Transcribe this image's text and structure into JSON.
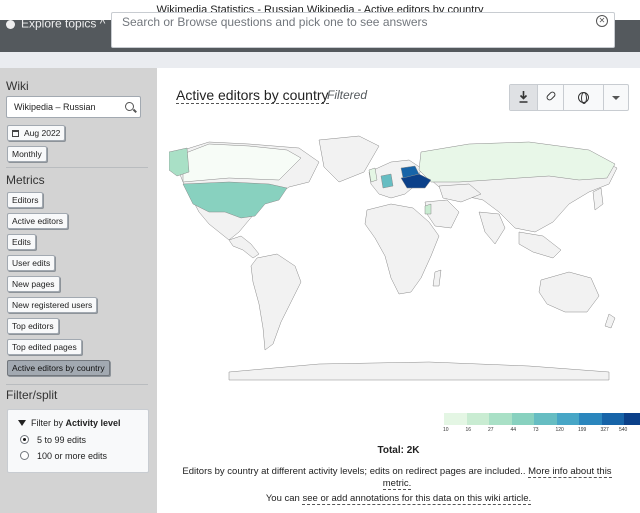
{
  "window": {
    "title": "Wikimedia Statistics - Russian Wikipedia - Active editors by country"
  },
  "topbar": {
    "explore_label": "Explore topics",
    "search_placeholder": "Search or Browse questions and pick one to see answers"
  },
  "sidebar": {
    "wiki_heading": "Wiki",
    "wiki_value": "Wikipedia – Russian",
    "date_label": "Aug 2022",
    "granularity_label": "Monthly",
    "metrics_heading": "Metrics",
    "metrics": [
      "Editors",
      "Active editors",
      "Edits",
      "User edits",
      "New pages",
      "New registered users",
      "Top editors",
      "Top edited pages",
      "Active editors by country"
    ],
    "active_metric": "Active editors by country",
    "filter_heading": "Filter/split",
    "filter_title_prefix": "Filter by",
    "filter_title_bold": "Activity level",
    "filter_options": [
      "5 to 99 edits",
      "100 or more edits"
    ],
    "filter_selected": "5 to 99 edits"
  },
  "main": {
    "title": "Active editors by country",
    "subtitle": "Filtered",
    "toolbar": {
      "download": "download-icon",
      "link": "link-icon",
      "language": "globe-icon",
      "more": "chevron-down-icon"
    },
    "legend": {
      "ticks": [
        "10",
        "16",
        "27",
        "44",
        "73",
        "120",
        "199",
        "327",
        "540"
      ],
      "colors": [
        "#e4f6e4",
        "#c9ecd2",
        "#a9e0c6",
        "#88d1bf",
        "#66bdc2",
        "#47a6c6",
        "#2b86bd",
        "#1764a8",
        "#0b4089"
      ]
    },
    "total": "Total: 2K",
    "description": "Editors by country at different activity levels; edits on redirect pages are included..",
    "more_info_link": "More info about this metric.",
    "annotation_prefix": "You can",
    "annotation_link": "see or add annotations for this data on this wiki article."
  }
}
